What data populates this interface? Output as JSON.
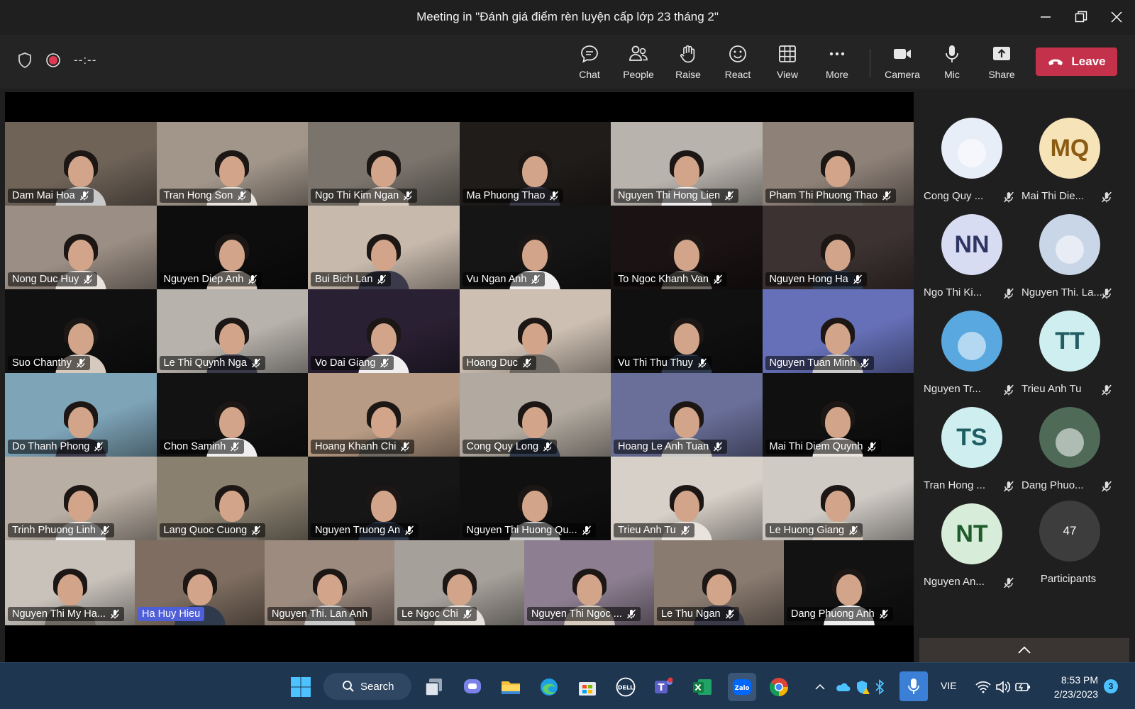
{
  "window": {
    "title": "Meeting in \"Đánh giá điểm rèn luyện cấp lớp 23 tháng 2\""
  },
  "toolbar": {
    "timer": "--:--",
    "buttons": [
      {
        "id": "chat",
        "label": "Chat",
        "icon": "chat-icon"
      },
      {
        "id": "people",
        "label": "People",
        "icon": "people-icon"
      },
      {
        "id": "raise",
        "label": "Raise",
        "icon": "hand-icon"
      },
      {
        "id": "react",
        "label": "React",
        "icon": "smile-icon"
      },
      {
        "id": "view",
        "label": "View",
        "icon": "grid-icon"
      },
      {
        "id": "more",
        "label": "More",
        "icon": "more-icon"
      },
      {
        "id": "camera",
        "label": "Camera",
        "icon": "camera-icon"
      },
      {
        "id": "mic",
        "label": "Mic",
        "icon": "mic-icon"
      },
      {
        "id": "share",
        "label": "Share",
        "icon": "share-icon"
      }
    ],
    "leave_label": "Leave"
  },
  "video_grid": {
    "rows": [
      [
        "Dam Mai Hoa",
        "Tran Hong Son",
        "Ngo Thi Kim Ngan",
        "Ma Phuong Thao",
        "Nguyen Thi Hong Lien",
        "Pham Thi Phuong Thao"
      ],
      [
        "Nong Duc Huy",
        "Nguyen Diep Anh",
        "Bui Bich Lan",
        "Vu Ngan Anh",
        "To Ngoc Khanh Van",
        "Nguyen Hong Ha"
      ],
      [
        "Suo Chanthy",
        "Le Thi Quynh Nga",
        "Vo Dai Giang",
        "Hoang Duc",
        "Vu Thi Thu Thuy",
        "Nguyen Tuan Minh"
      ],
      [
        "Do Thanh Phong",
        "Chon Saminh",
        "Hoang Khanh Chi",
        "Cong Quy Long",
        "Hoang Le Anh Tuan",
        "Mai Thi Diem Quynh"
      ],
      [
        "Trinh Phuong Linh",
        "Lang Quoc Cuong",
        "Nguyen Truong An",
        "Nguyen Thi Huong Qu...",
        "Trieu Anh Tu",
        "Le Huong Giang"
      ],
      [
        "Nguyen Thi My Ha...",
        "Ha Huy Hieu",
        "Nguyen Thi. Lan Anh",
        "Le Ngoc Chi",
        "Nguyen Thi Ngoc ...",
        "Le Thu Ngan",
        "Dang Phuong Anh"
      ]
    ]
  },
  "participants_panel": {
    "people": [
      {
        "name": "Cong Quy ...",
        "initials": "",
        "avatar_color": "#e8eef8"
      },
      {
        "name": "Mai Thi Die...",
        "initials": "MQ",
        "avatar_color": "#f7e3b8",
        "text_color": "#8a5b12"
      },
      {
        "name": "Ngo Thi Ki...",
        "initials": "NN",
        "avatar_color": "#d8dcf2",
        "text_color": "#2e3563"
      },
      {
        "name": "Nguyen Thi. La...",
        "initials": "",
        "avatar_color": "#c9d6e8"
      },
      {
        "name": "Nguyen Tr...",
        "initials": "",
        "avatar_color": "#5aa8e0"
      },
      {
        "name": "Trieu Anh Tu",
        "initials": "TT",
        "avatar_color": "#cfeef0",
        "text_color": "#1f5d63"
      },
      {
        "name": "Tran Hong ...",
        "initials": "TS",
        "avatar_color": "#cfeef0",
        "text_color": "#1f5d63"
      },
      {
        "name": "Dang Phuo...",
        "initials": "",
        "avatar_color": "#4f6b58"
      },
      {
        "name": "Nguyen An...",
        "initials": "NT",
        "avatar_color": "#d7ecd9",
        "text_color": "#1e5b2a"
      }
    ],
    "more_count": "47",
    "more_label": "Participants"
  },
  "taskbar": {
    "search_label": "Search",
    "language": "VIE",
    "time": "8:53 PM",
    "date": "2/23/2023",
    "notification_count": "3"
  }
}
